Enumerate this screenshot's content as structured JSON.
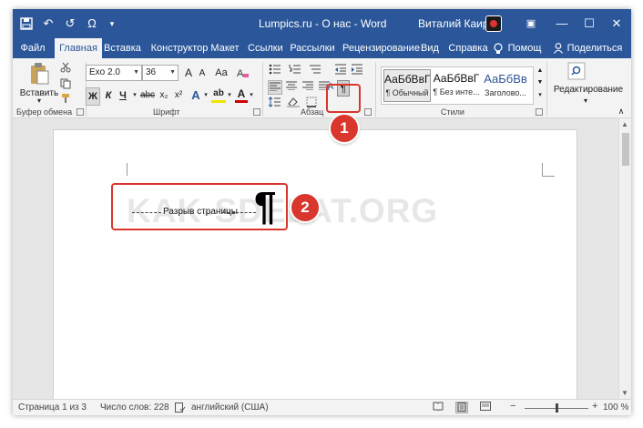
{
  "title_bar": {
    "document_title": "Lumpics.ru - О нас - Word",
    "user_name": "Виталий Каиров",
    "quick_access": [
      "save-icon",
      "undo-icon",
      "redo-icon",
      "symbol-omega-icon",
      "customize-icon"
    ],
    "quick_access_glyphs": {
      "undo": "↶",
      "redo": "↺",
      "omega": "Ω",
      "customize": "▾"
    },
    "window_controls": {
      "ribbon_display": "▣",
      "minimize": "—",
      "maximize": "☐",
      "close": "✕"
    }
  },
  "tabs": [
    {
      "label": "Файл",
      "active": false
    },
    {
      "label": "Главная",
      "active": true
    },
    {
      "label": "Вставка",
      "active": false
    },
    {
      "label": "Конструктор",
      "active": false
    },
    {
      "label": "Макет",
      "active": false
    },
    {
      "label": "Ссылки",
      "active": false
    },
    {
      "label": "Рассылки",
      "active": false
    },
    {
      "label": "Рецензирование",
      "active": false
    },
    {
      "label": "Вид",
      "active": false
    },
    {
      "label": "Справка",
      "active": false
    },
    {
      "label": "Помощ",
      "active": false
    },
    {
      "label": "Поделиться",
      "active": false
    }
  ],
  "ribbon": {
    "clipboard": {
      "group_label": "Буфер обмена",
      "paste_label": "Вставить",
      "icons": [
        "paste-icon",
        "cut-icon",
        "copy-icon",
        "format-painter-icon"
      ]
    },
    "font": {
      "group_label": "Шрифт",
      "font_name": "Exo 2.0",
      "font_size": "36",
      "grow_label": "A",
      "shrink_label": "A",
      "case_label": "Aa",
      "bold": "Ж",
      "italic": "К",
      "underline": "Ч",
      "strikethrough": "abc",
      "subscript": "x₂",
      "superscript": "x²",
      "text_effects": "A",
      "highlight": "ab",
      "font_color": "A"
    },
    "paragraph": {
      "group_label": "Абзац",
      "show_marks_symbol": "¶",
      "sort_label": "А",
      "icons": [
        "bullets-icon",
        "numbering-icon",
        "multilevel-icon",
        "decrease-indent-icon",
        "increase-indent-icon",
        "align-left-icon",
        "align-center-icon",
        "align-right-icon",
        "justify-icon",
        "line-spacing-icon",
        "shading-icon",
        "borders-icon",
        "sort-icon",
        "show-formatting-marks-icon"
      ]
    },
    "styles": {
      "group_label": "Стили",
      "items": [
        {
          "sample": "АаБбВвГ",
          "name": "¶ Обычный",
          "selected": true
        },
        {
          "sample": "АаБбВвГ",
          "name": "¶ Без инте...",
          "selected": false
        },
        {
          "sample": "АаБбВв",
          "name": "Заголово...",
          "selected": false
        }
      ]
    },
    "editing": {
      "label": "Редактирование",
      "icon": "find-icon"
    }
  },
  "document": {
    "watermark": "KAK-SDELAT.ORG",
    "page_break_label": "Разрыв страницы",
    "pilcrow": "¶"
  },
  "annotations": [
    {
      "number": "1",
      "target": "show-formatting-marks-button"
    },
    {
      "number": "2",
      "target": "page-break-marker"
    }
  ],
  "status_bar": {
    "page": "Страница 1 из 3",
    "words": "Число слов: 228",
    "language": "английский (США)",
    "zoom_minus": "−",
    "zoom_plus": "+",
    "zoom": "100 %"
  },
  "colors": {
    "accent": "#2b579a",
    "highlight": "#d9362d",
    "ribbon_bg": "#f3f3f3",
    "workspace_bg": "#e6e6e6",
    "text_effects": "#2b579a",
    "highlight_marker": "#f2e400",
    "font_color_bar": "#d00000"
  }
}
